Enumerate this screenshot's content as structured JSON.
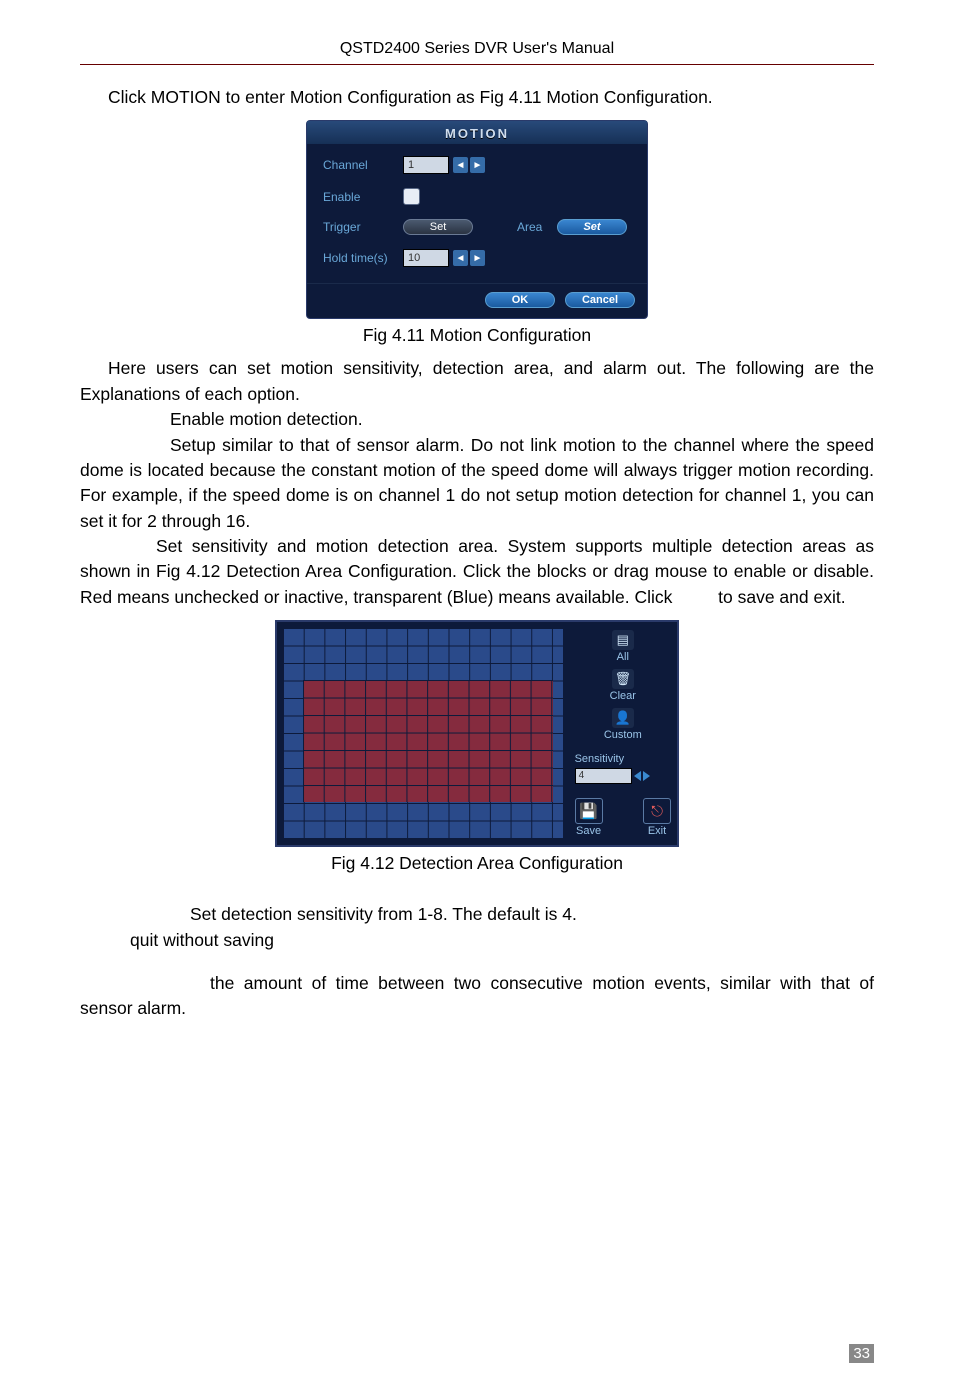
{
  "header": "QSTD2400 Series DVR User's Manual",
  "p1": "Click MOTION to enter Motion Configuration as Fig 4.11 Motion Configuration.",
  "motion_dialog": {
    "title": "MOTION",
    "channel_label": "Channel",
    "channel_value": "1",
    "enable_label": "Enable",
    "trigger_label": "Trigger",
    "trigger_set": "Set",
    "area_label": "Area",
    "area_set": "Set",
    "hold_label": "Hold time(s)",
    "hold_value": "10",
    "ok": "OK",
    "cancel": "Cancel"
  },
  "cap1": "Fig 4.11 Motion Configuration",
  "p2": "Here users can set motion sensitivity, detection area, and alarm out. The following are the Explanations of each option.",
  "p3": "Enable motion detection.",
  "p4": "Setup similar to that of sensor alarm. Do not link motion to the channel where the speed dome is located because the constant motion of the speed dome will always trigger motion recording. For example, if the speed dome is on channel 1 do not setup motion detection for channel 1, you can set it for 2 through 16.",
  "p5a": "Set sensitivity and motion detection area. System supports multiple detection areas as shown in Fig 4.12 Detection Area Configuration. Click the blocks or drag mouse to enable or disable. Red means unchecked or inactive, transparent (Blue) means available. Click",
  "p5b": "to save and exit.",
  "det_area": {
    "all": "All",
    "clear": "Clear",
    "custom": "Custom",
    "sensitivity_label": "Sensitivity",
    "sensitivity_value": "4",
    "save": "Save",
    "exit": "Exit"
  },
  "cap2": "Fig 4.12 Detection Area Configuration",
  "p6": "Set detection sensitivity from 1-8. The default is 4.",
  "p7": "quit without saving",
  "p8": "the amount of time between two consecutive motion events, similar with that of sensor alarm.",
  "page_number": "33"
}
